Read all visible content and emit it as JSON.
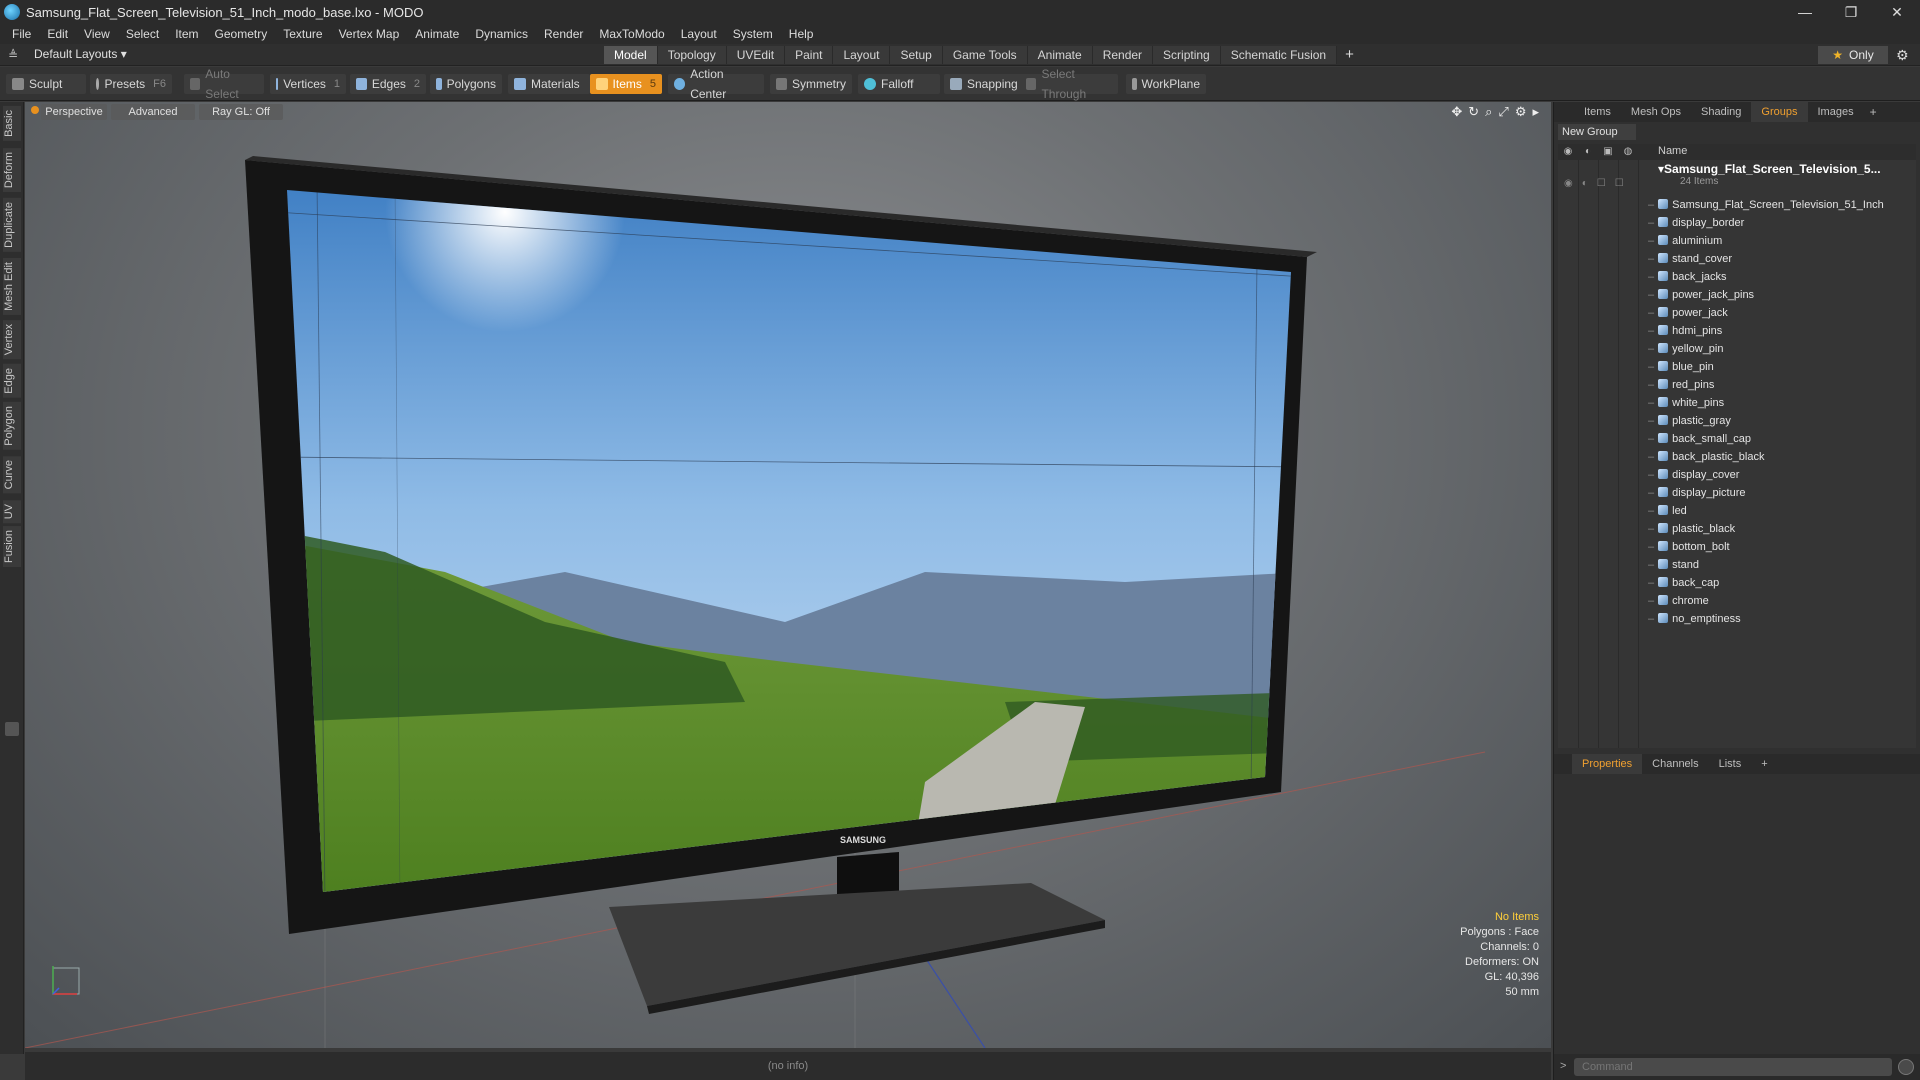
{
  "window": {
    "title": "Samsung_Flat_Screen_Television_51_Inch_modo_base.lxo - MODO",
    "minimize": "—",
    "maximize": "❐",
    "close": "✕"
  },
  "menu": [
    "File",
    "Edit",
    "View",
    "Select",
    "Item",
    "Geometry",
    "Texture",
    "Vertex Map",
    "Animate",
    "Dynamics",
    "Render",
    "MaxToModo",
    "Layout",
    "System",
    "Help"
  ],
  "layout": {
    "select_label": "Default Layouts ▾",
    "tabs": [
      "Model",
      "Topology",
      "UVEdit",
      "Paint",
      "Layout",
      "Setup",
      "Game Tools",
      "Animate",
      "Render",
      "Scripting",
      "Schematic Fusion"
    ],
    "active_tab": "Model",
    "add": "+",
    "only_label": "Only"
  },
  "toolbar": {
    "sculpt": "Sculpt",
    "presets": "Presets",
    "presets_key": "F6",
    "auto_select": "Auto Select",
    "vertices": "Vertices",
    "vertices_count": "1",
    "edges": "Edges",
    "edges_count": "2",
    "polygons": "Polygons",
    "materials": "Materials",
    "items": "Items",
    "items_count": "5",
    "action_center": "Action Center",
    "symmetry": "Symmetry",
    "falloff": "Falloff",
    "snapping": "Snapping",
    "select_through": "Select Through",
    "workplane": "WorkPlane"
  },
  "left_tabs": [
    "Basic",
    "Deform",
    "Duplicate",
    "Mesh Edit",
    "Vertex",
    "Edge",
    "Polygon",
    "Curve",
    "UV",
    "Fusion"
  ],
  "viewport": {
    "perspective": "Perspective",
    "advanced": "Advanced",
    "raygl": "Ray GL: Off",
    "brand": "SAMSUNG",
    "hud": {
      "selection": "No Items",
      "polygons": "Polygons : Face",
      "channels": "Channels: 0",
      "deformers": "Deformers: ON",
      "gl": "GL: 40,396",
      "focal": "50 mm"
    }
  },
  "status": "(no info)",
  "right_panel": {
    "tabs": [
      "Items",
      "Mesh Ops",
      "Shading",
      "Groups",
      "Images"
    ],
    "active_tab": "Groups",
    "add": "+",
    "new_group": "New Group",
    "name_header": "Name",
    "root": {
      "name": "Samsung_Flat_Screen_Television_5...",
      "count": "24 Items"
    },
    "items": [
      "Samsung_Flat_Screen_Television_51_Inch",
      "display_border",
      "aluminium",
      "stand_cover",
      "back_jacks",
      "power_jack_pins",
      "power_jack",
      "hdmi_pins",
      "yellow_pin",
      "blue_pin",
      "red_pins",
      "white_pins",
      "plastic_gray",
      "back_small_cap",
      "back_plastic_black",
      "display_cover",
      "display_picture",
      "led",
      "plastic_black",
      "bottom_bolt",
      "stand",
      "back_cap",
      "chrome",
      "no_emptiness"
    ],
    "props_tabs": [
      "Properties",
      "Channels",
      "Lists"
    ],
    "props_active": "Properties",
    "command_prompt": ">",
    "command_placeholder": "Command"
  },
  "colors": {
    "accent": "#e8911f",
    "tab_active_text": "#f0a030",
    "hud_highlight": "#ffcf3a"
  }
}
